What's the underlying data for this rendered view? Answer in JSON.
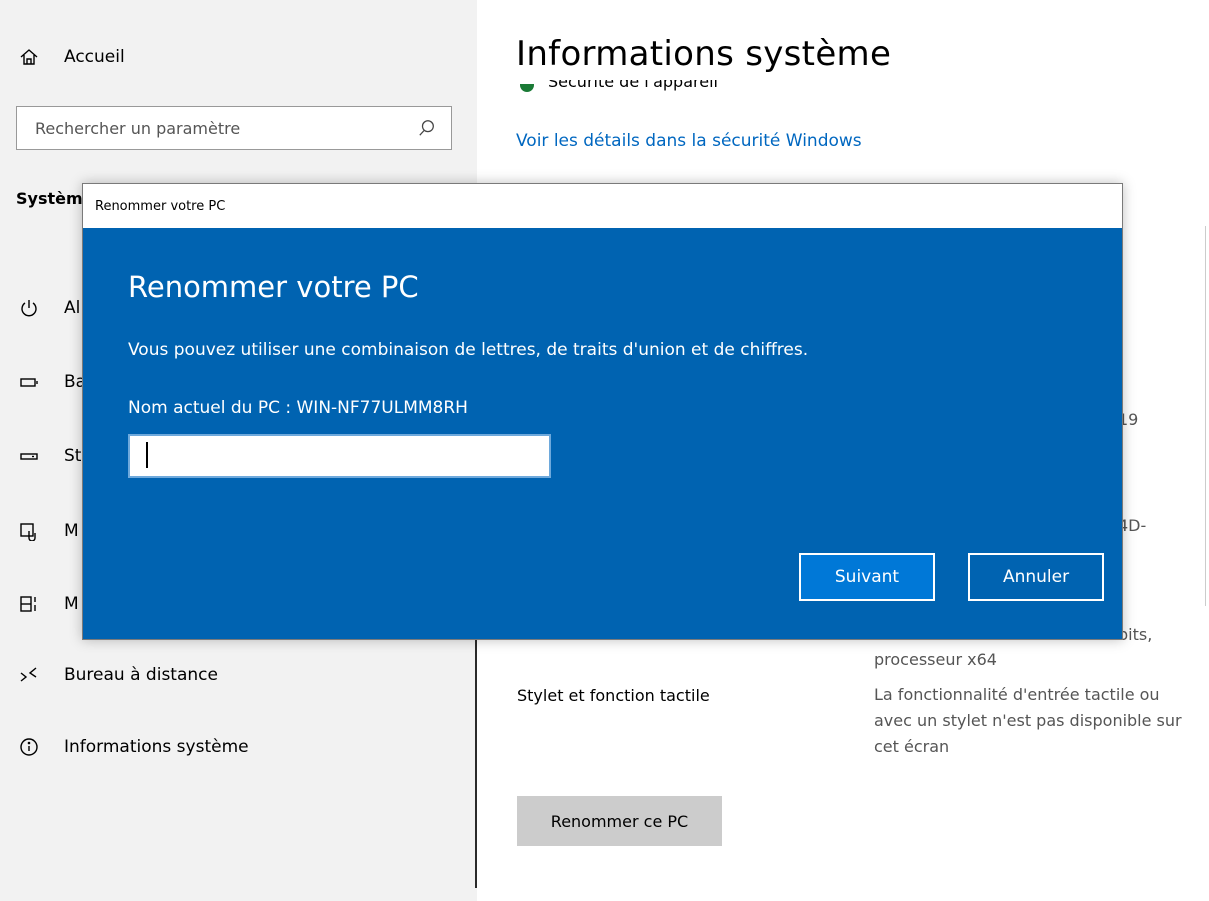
{
  "sidebar": {
    "home_label": "Accueil",
    "search_placeholder": "Rechercher un paramètre",
    "section_label": "Systèm",
    "items": [
      {
        "label": "Al",
        "icon": "power-icon"
      },
      {
        "label": "Ba",
        "icon": "battery-icon"
      },
      {
        "label": "St",
        "icon": "storage-icon"
      },
      {
        "label": "M",
        "icon": "tablet-mode-icon"
      },
      {
        "label": "M",
        "icon": "multitasking-icon"
      },
      {
        "label": "Bureau à distance",
        "icon": "remote-desktop-icon"
      },
      {
        "label": "Informations système",
        "icon": "info-icon"
      }
    ]
  },
  "main": {
    "title": "Informations système",
    "cut_heading": "Sécurité de l'appareil",
    "security_link": "Voir les détails dans la sécurité Windows",
    "fragments": {
      "f1": "19",
      "f2": "4D-",
      "f3": "bits,"
    },
    "processor_line": "processeur x64",
    "pen_touch_label": "Stylet et fonction tactile",
    "pen_touch_value": "La fonctionnalité d'entrée tactile ou avec un stylet n'est pas disponible sur cet écran",
    "rename_button": "Renommer ce PC"
  },
  "dialog": {
    "window_title": "Renommer votre PC",
    "heading": "Renommer votre PC",
    "description": "Vous pouvez utiliser une combinaison de lettres, de traits d'union et de chiffres.",
    "current_name": "Nom actuel du PC : WIN-NF77ULMM8RH",
    "input_value": "",
    "next_button": "Suivant",
    "cancel_button": "Annuler"
  },
  "colors": {
    "dialog_bg": "#0063b1",
    "primary_button": "#0078d7",
    "link": "#0067c0",
    "sidebar_bg": "#f2f2f2"
  }
}
